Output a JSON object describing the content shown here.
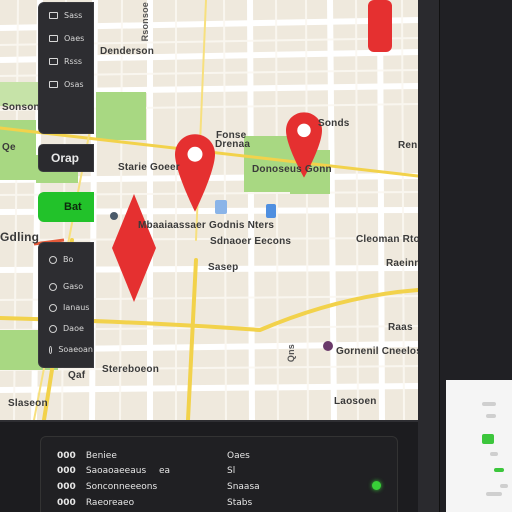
{
  "map": {
    "labels": {
      "l1": "Denderson",
      "l2": "Sonsonen",
      "l3": "Starie Goeer",
      "l4": "Fonse",
      "l5": "Sonds",
      "l6": "Donoseus Gonn",
      "l7": "Drenaa",
      "l8": "Mbaaiaassaer Godnis Nters",
      "l9": "Sdnaoer Eecons",
      "l10": "Sasep",
      "l11": "Cleoman Rto",
      "l12": "Raeinn",
      "l13": "Gdling",
      "l14": "Stereboeon",
      "l15": "Slaseon",
      "l16": "Qaf",
      "l17": "Laosoen",
      "l18": "Gornenil Cneelos",
      "l19": "Raas",
      "l20": "Renn",
      "l21": "Qe",
      "l22": "Rsonsoe",
      "l23": "Qns"
    }
  },
  "right_panel": {
    "menu_items": [
      {
        "icon": "layers-icon",
        "label": "Sass"
      },
      {
        "icon": "pin-icon",
        "label": "Oaes"
      },
      {
        "icon": "route-icon",
        "label": "Rsss"
      },
      {
        "icon": "list-icon",
        "label": "Osas"
      }
    ],
    "clear_label": "Orap",
    "go_label": "Bat",
    "options": [
      {
        "label": "Bo"
      },
      {
        "label": "Gaso"
      },
      {
        "label": "Ianaus"
      },
      {
        "label": "Daoe"
      },
      {
        "label": "Soaeoan"
      }
    ]
  },
  "bottom_panel": {
    "rows": [
      {
        "num": "000",
        "name": "Beniee",
        "extra": "",
        "value": "Oaes"
      },
      {
        "num": "000",
        "name": "Saoaoaeeaus",
        "extra": "ea",
        "value": "Sl"
      },
      {
        "num": "000",
        "name": "Sonconneeeons",
        "extra": "",
        "value": "Snaasa"
      },
      {
        "num": "000",
        "name": "Raeoreaeo",
        "extra": "",
        "value": "Stabs"
      }
    ]
  },
  "colors": {
    "map_bg": "#efe9dd",
    "road_major": "#f2d24b",
    "park": "#a8d882",
    "pin_red": "#e53030",
    "accent_green": "#22c22a",
    "panel_dark": "#202024"
  }
}
